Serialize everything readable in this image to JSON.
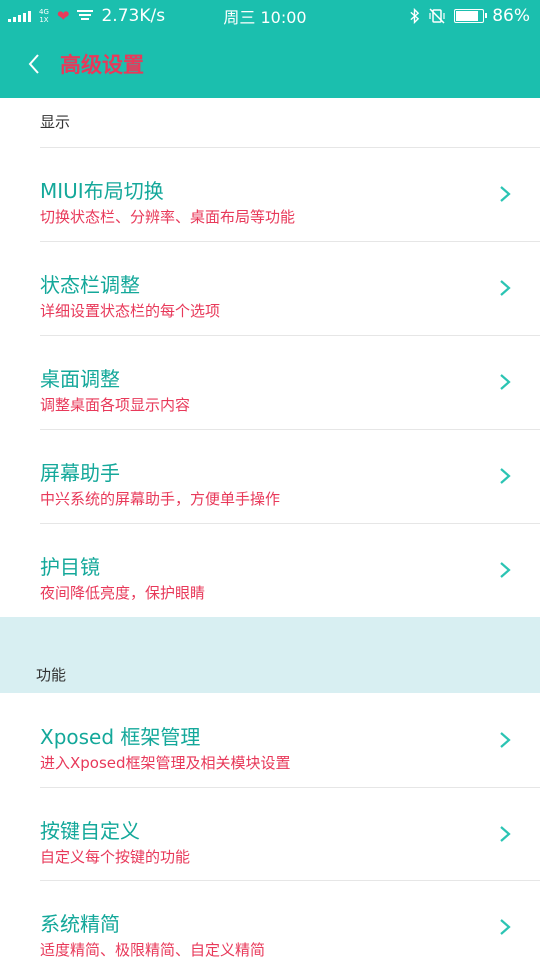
{
  "status_bar": {
    "network_top": "4G",
    "network_bottom": "1X",
    "speed": "2.73K/s",
    "day": "周三",
    "time": "10:00",
    "battery_percent": "86%",
    "battery_level": 0.86
  },
  "app_bar": {
    "title": "高级设置"
  },
  "sections": [
    {
      "header": "显示",
      "items": [
        {
          "title": "MIUI布局切换",
          "subtitle": "切换状态栏、分辨率、桌面布局等功能"
        },
        {
          "title": "状态栏调整",
          "subtitle": "详细设置状态栏的每个选项"
        },
        {
          "title": "桌面调整",
          "subtitle": "调整桌面各项显示内容"
        },
        {
          "title": "屏幕助手",
          "subtitle": "中兴系统的屏幕助手，方便单手操作"
        },
        {
          "title": "护目镜",
          "subtitle": "夜间降低亮度，保护眼睛"
        }
      ]
    },
    {
      "header": "功能",
      "items": [
        {
          "title": "Xposed 框架管理",
          "subtitle": "进入Xposed框架管理及相关模块设置"
        },
        {
          "title": "按键自定义",
          "subtitle": "自定义每个按键的功能"
        },
        {
          "title": "系统精简",
          "subtitle": "适度精简、极限精简、自定义精简"
        }
      ]
    }
  ],
  "colors": {
    "accent": "#1bbfae",
    "title_text": "#14a89a",
    "subtitle_text": "#e8395a",
    "section_band": "#d8eff2"
  },
  "icons": {
    "back": "chevron-left-icon",
    "item_arrow": "chevron-right-icon",
    "bluetooth": "bluetooth-icon",
    "mute": "vibrate-off-icon",
    "wifi": "wifi-icon",
    "signal": "signal-icon",
    "notification": "heart-icon"
  }
}
